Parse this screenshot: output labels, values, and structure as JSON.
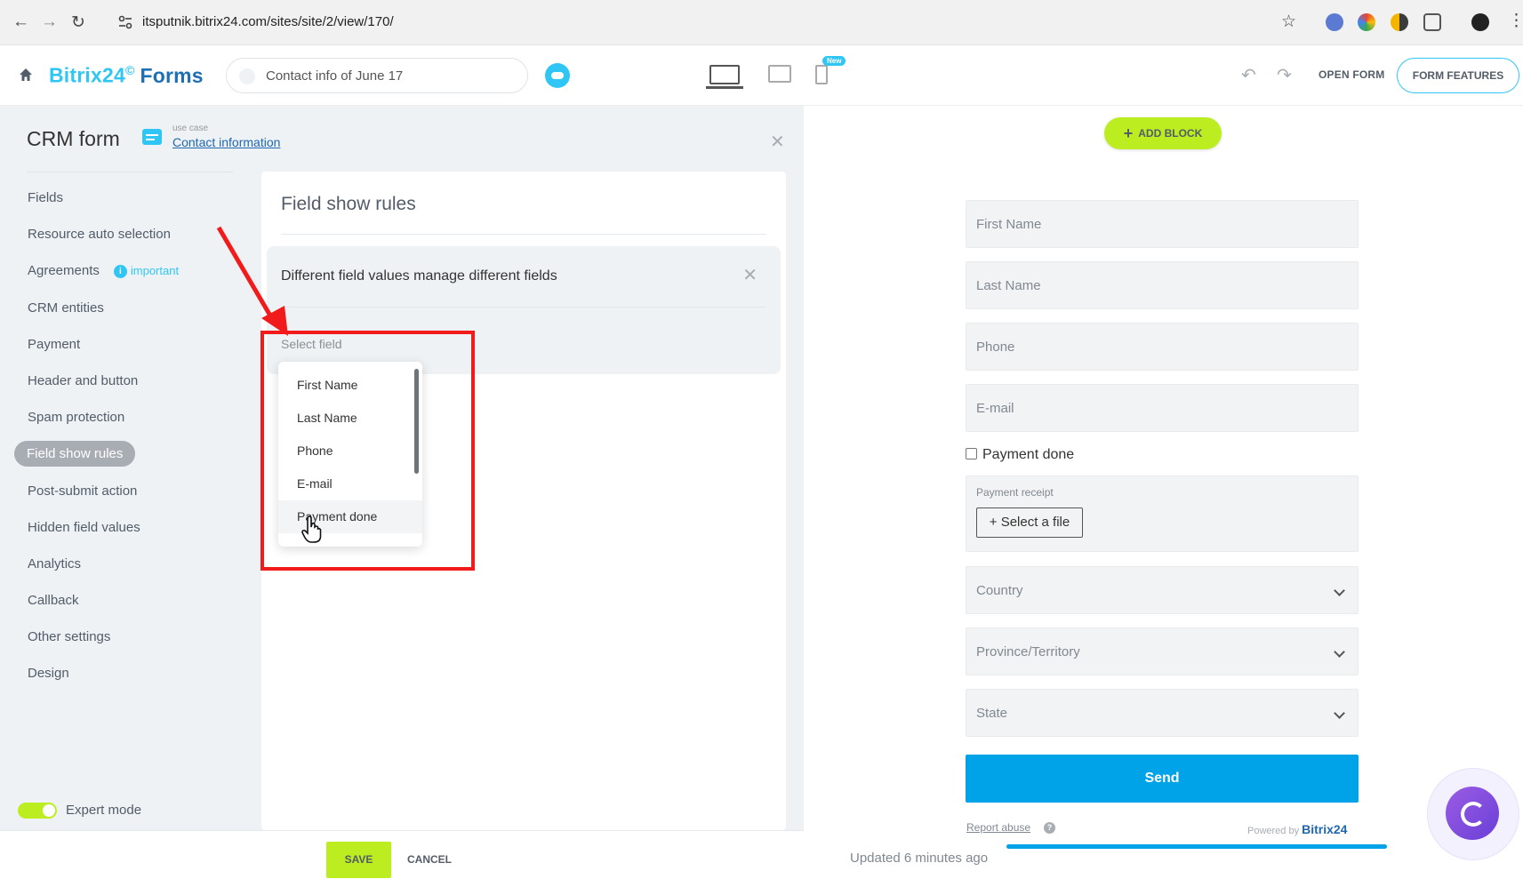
{
  "browser": {
    "url": "itsputnik.bitrix24.com/sites/site/2/view/170/"
  },
  "header": {
    "logo_brand": "Bitrix24",
    "logo_mark": "©",
    "logo_product": "Forms",
    "form_title": "Contact info of June 17",
    "new_badge": "New",
    "open_form": "OPEN FORM",
    "form_features": "FORM FEATURES"
  },
  "left": {
    "title": "CRM form",
    "use_case_caption": "use case",
    "use_case_link": "Contact information",
    "nav": [
      {
        "label": "Fields"
      },
      {
        "label": "Resource auto selection"
      },
      {
        "label": "Agreements",
        "badge": "important"
      },
      {
        "label": "CRM entities"
      },
      {
        "label": "Payment"
      },
      {
        "label": "Header and button"
      },
      {
        "label": "Spam protection"
      },
      {
        "label": "Field show rules",
        "active": true
      },
      {
        "label": "Post-submit action"
      },
      {
        "label": "Hidden field values"
      },
      {
        "label": "Analytics"
      },
      {
        "label": "Callback"
      },
      {
        "label": "Other settings"
      },
      {
        "label": "Design"
      }
    ],
    "expert_mode": "Expert mode",
    "save": "SAVE",
    "cancel": "CANCEL"
  },
  "card": {
    "title": "Field show rules",
    "rule_text": "Different field values manage different fields",
    "select_label": "Select field",
    "dropdown_options": [
      "First Name",
      "Last Name",
      "Phone",
      "E-mail",
      "Payment done"
    ]
  },
  "preview": {
    "add_block": "ADD BLOCK",
    "fields": {
      "first_name": "First Name",
      "last_name": "Last Name",
      "phone": "Phone",
      "email": "E-mail",
      "country": "Country",
      "province": "Province/Territory",
      "state": "State"
    },
    "payment_done": "Payment done",
    "payment_receipt": "Payment receipt",
    "select_file": "Select a file",
    "send": "Send",
    "report_abuse": "Report abuse",
    "powered_by": "Powered by",
    "powered_brand": "Bitrix24",
    "updated": "Updated 6 minutes ago"
  },
  "colors": {
    "accent_blue": "#2fc6f6",
    "send_blue": "#00a2e8",
    "lime": "#bbed21",
    "highlight_red": "#f21b1b"
  }
}
